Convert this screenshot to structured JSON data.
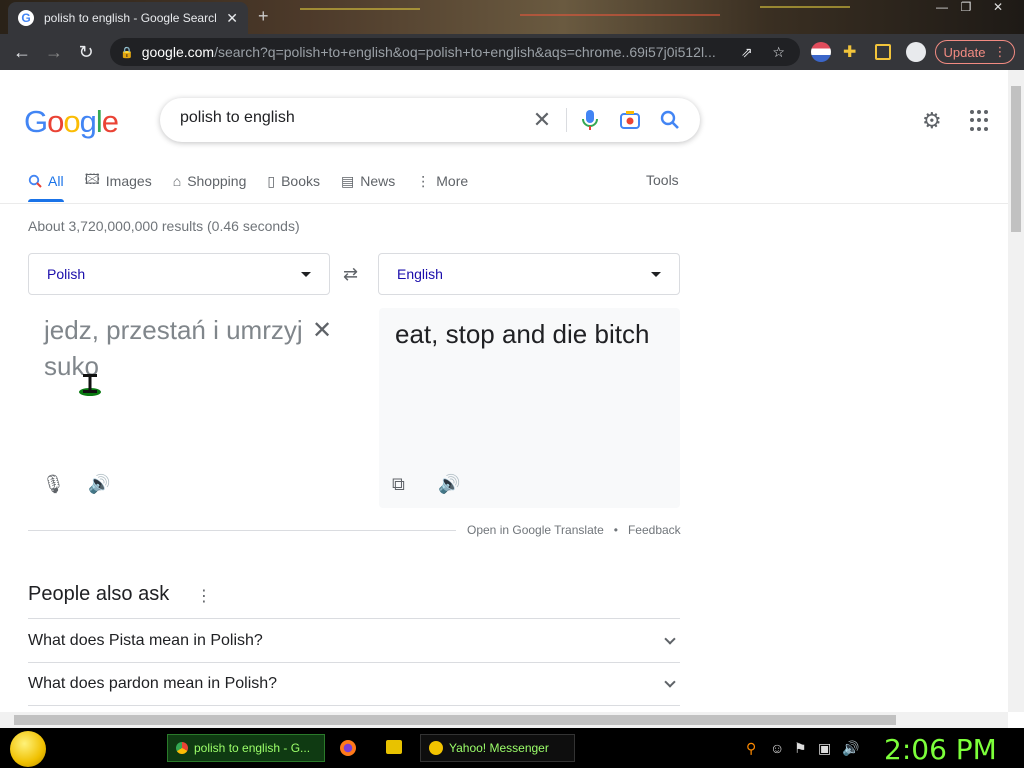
{
  "browser": {
    "tab_title": "polish to english - Google Search",
    "tab_close": "✕",
    "new_tab": "+",
    "url_host": "google.com",
    "url_path": "/search?q=polish+to+english&oq=polish+to+english&aqs=chrome..69i57j0i512l...",
    "update_label": "Update"
  },
  "search": {
    "query": "polish to english"
  },
  "nav_tabs": [
    {
      "label": "All",
      "icon": "search-icon"
    },
    {
      "label": "Images",
      "icon": "image-icon"
    },
    {
      "label": "Shopping",
      "icon": "tag-icon"
    },
    {
      "label": "Books",
      "icon": "book-icon"
    },
    {
      "label": "News",
      "icon": "newspaper-icon"
    },
    {
      "label": "More",
      "icon": "more-vertical-icon"
    }
  ],
  "tools_label": "Tools",
  "result_stats": "About 3,720,000,000 results (0.46 seconds)",
  "translate": {
    "source_lang": "Polish",
    "target_lang": "English",
    "source_text": "jedz, przestań i umrzyj suko",
    "target_text": "eat, stop and die bitch",
    "open_link": "Open in Google Translate",
    "separator": "•",
    "feedback": "Feedback"
  },
  "paa": {
    "title": "People also ask",
    "questions": [
      "What does Pista mean in Polish?",
      "What does pardon mean in Polish?"
    ]
  },
  "taskbar": {
    "chrome_task": "polish to english - G...",
    "yahoo_task": "Yahoo! Messenger",
    "clock": "2:06 PM"
  },
  "colors": {
    "google_blue": "#4285f4",
    "google_red": "#ea4335",
    "google_yellow": "#fbbc05",
    "google_green": "#34a853",
    "link_blue": "#1a73e8",
    "clock_green": "#7cff3a"
  }
}
